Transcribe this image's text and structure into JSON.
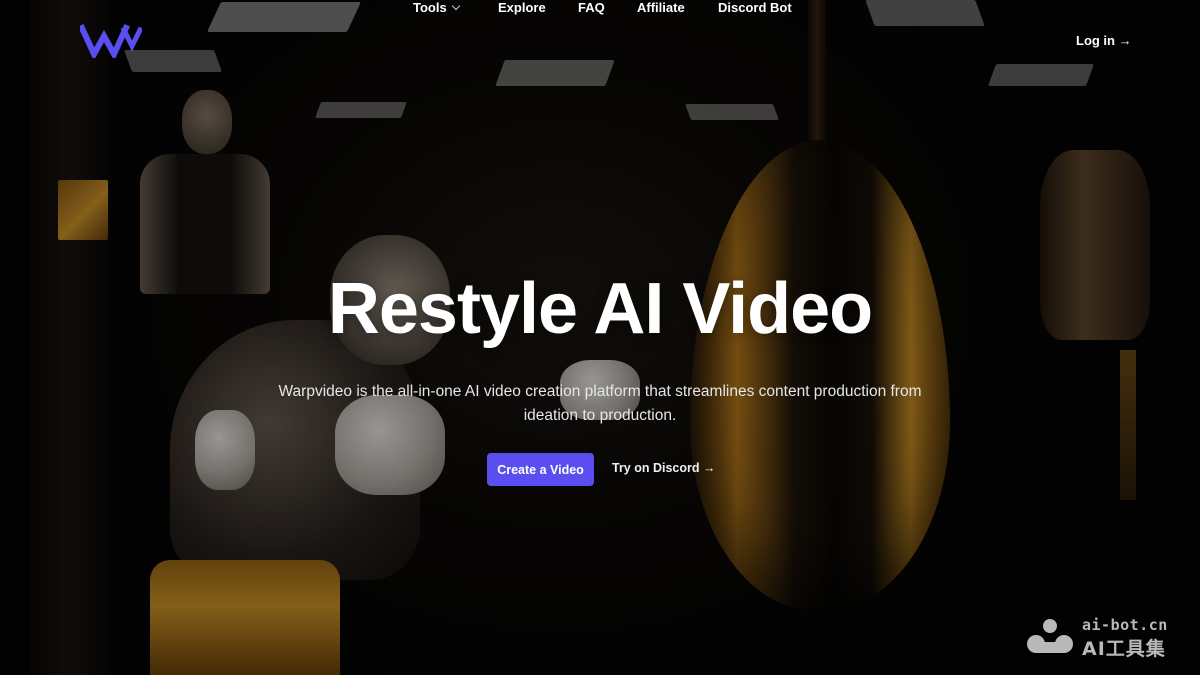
{
  "header": {
    "logo_icon": "warpvideo-w-logo-icon",
    "brand_color": "#5b4ef0",
    "nav": [
      {
        "label": "Tools",
        "has_dropdown": true
      },
      {
        "label": "Explore"
      },
      {
        "label": "FAQ"
      },
      {
        "label": "Affiliate"
      },
      {
        "label": "Discord Bot"
      }
    ],
    "login_label": "Log in →"
  },
  "hero": {
    "title": "Restyle AI Video",
    "subtitle_line1": "Warpvideo is the all-in-one AI video creation platform that streamlines content production from",
    "subtitle_line2": "ideation to production.",
    "primary_cta": "Create a Video",
    "secondary_cta": "Try on Discord →",
    "primary_cta_color": "#5b4ef0"
  },
  "watermark": {
    "url": "ai-bot.cn",
    "name": "AI工具集"
  }
}
